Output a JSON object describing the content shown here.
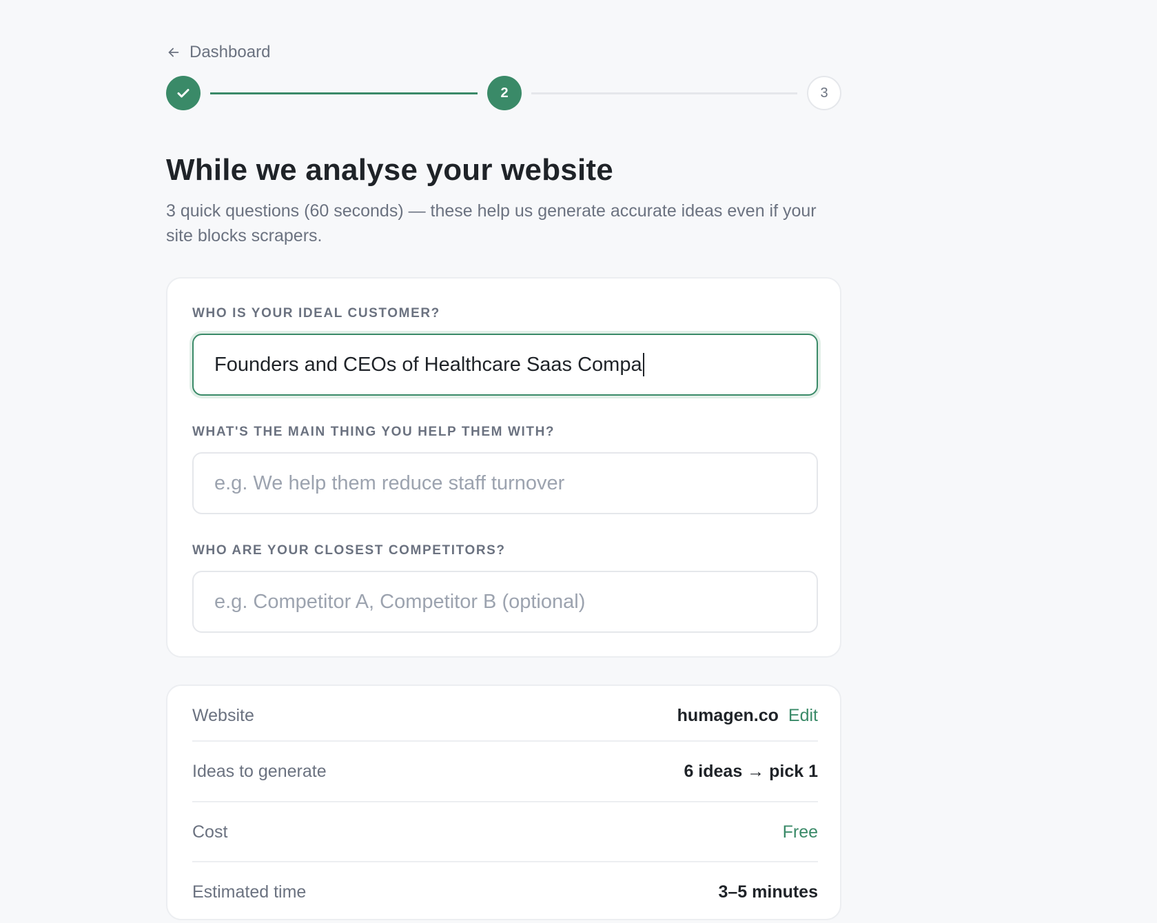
{
  "nav": {
    "back_label": "Dashboard"
  },
  "stepper": {
    "steps": [
      {
        "label": "",
        "state": "completed"
      },
      {
        "label": "2",
        "state": "current"
      },
      {
        "label": "3",
        "state": "upcoming"
      }
    ]
  },
  "header": {
    "title": "While we analyse your website",
    "subtitle": "3 quick questions (60 seconds) — these help us generate accurate ideas even if your site blocks scrapers."
  },
  "questions": [
    {
      "label": "WHO IS YOUR IDEAL CUSTOMER?",
      "value": "Founders and CEOs of Healthcare Saas Compa",
      "placeholder": ""
    },
    {
      "label": "WHAT'S THE MAIN THING YOU HELP THEM WITH?",
      "value": "",
      "placeholder": "e.g. We help them reduce staff turnover"
    },
    {
      "label": "WHO ARE YOUR CLOSEST COMPETITORS?",
      "value": "",
      "placeholder": "e.g. Competitor A, Competitor B (optional)"
    }
  ],
  "summary": {
    "website": {
      "label": "Website",
      "value": "humagen.co",
      "edit_label": "Edit"
    },
    "ideas": {
      "label": "Ideas to generate",
      "value": "6 ideas → pick 1"
    },
    "cost": {
      "label": "Cost",
      "value": "Free"
    },
    "time": {
      "label": "Estimated time",
      "value": "3–5 minutes"
    }
  },
  "colors": {
    "accent": "#3a8a68",
    "background": "#f7f8fa",
    "muted": "#6b7280"
  }
}
